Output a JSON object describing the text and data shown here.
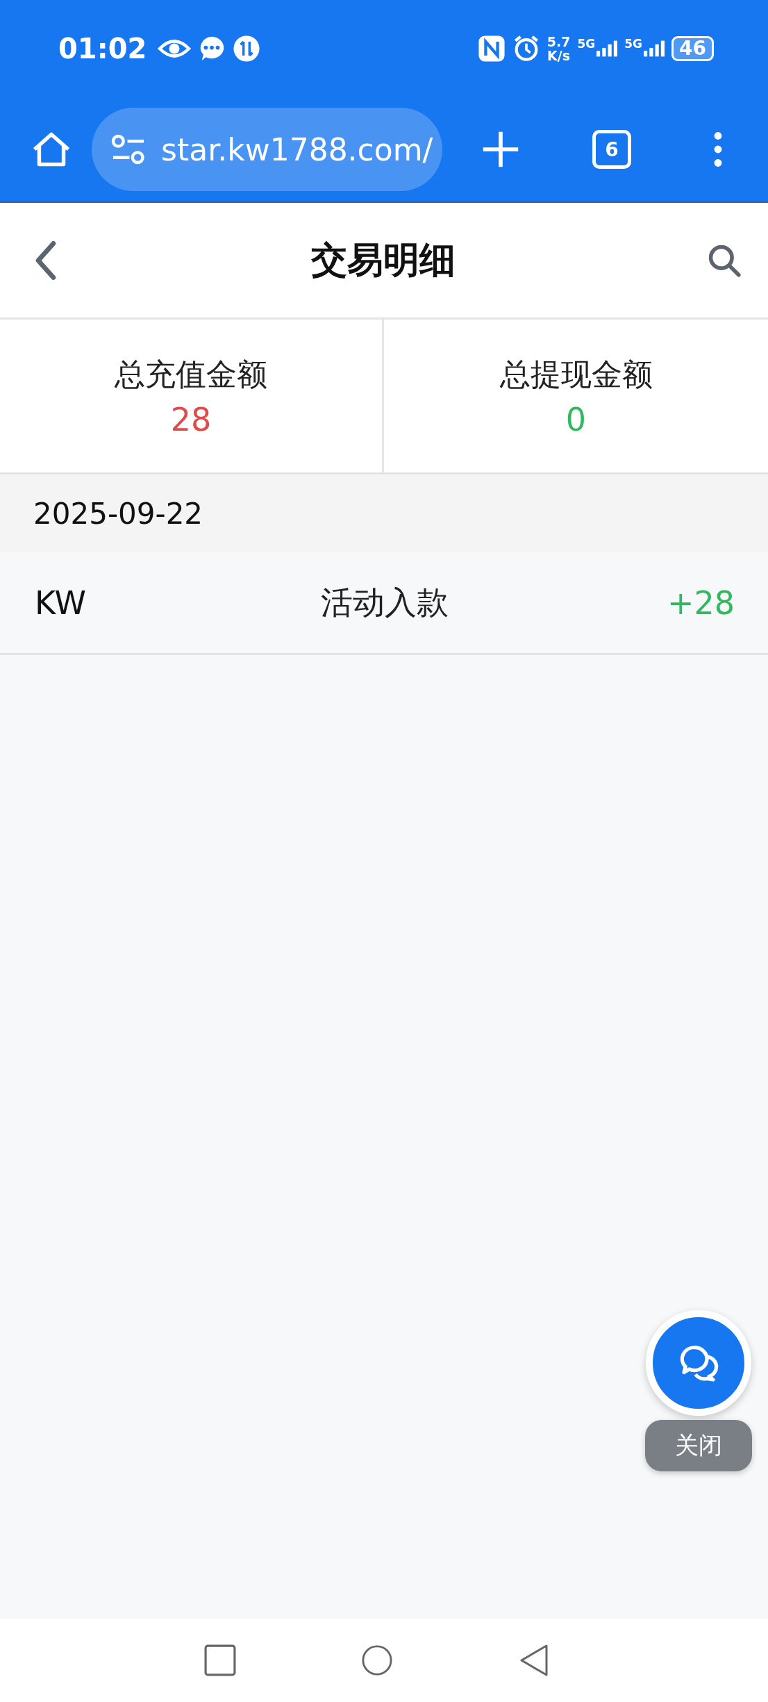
{
  "status_bar": {
    "time": "01:02",
    "speed_value": "5.7",
    "speed_unit": "K/s",
    "sim_1": "5G",
    "sim_2": "5G",
    "battery": "46"
  },
  "browser_bar": {
    "url": "star.kw1788.com/",
    "tab_count": "6"
  },
  "header": {
    "title": "交易明细"
  },
  "summary": [
    {
      "label": "总充值金额",
      "value": "28",
      "color": "#e04a4a"
    },
    {
      "label": "总提现金额",
      "value": "0",
      "color": "#33b85f"
    }
  ],
  "groups": [
    {
      "date": "2025-09-22",
      "transactions": [
        {
          "account": "KW",
          "type": "活动入款",
          "amount": "+28"
        }
      ]
    }
  ],
  "floating": {
    "close_label": "关闭"
  }
}
